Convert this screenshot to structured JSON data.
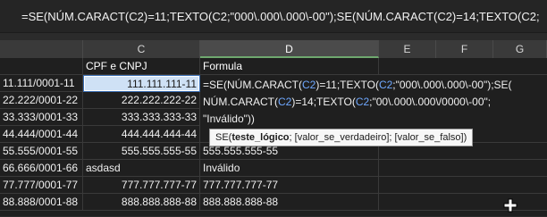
{
  "formula_bar": {
    "text": "=SE(NÚM.CARACT(C2)=11;TEXTO(C2;\"000\\.000\\.000\\-00\");SE(NÚM.CARACT(C2)=14;TEXTO(C2;"
  },
  "columns": [
    "C",
    "D",
    "E",
    "F",
    "G"
  ],
  "rows": [
    {
      "b": "",
      "c": "CPF e CNPJ",
      "d": "Formula"
    },
    {
      "b": "11.111/0001-11",
      "c": "111.111.111-11",
      "d": ""
    },
    {
      "b": "22.222/0001-22",
      "c": "222.222.222-22",
      "d": ""
    },
    {
      "b": "33.333/0001-33",
      "c": "333.333.333-33",
      "d": ""
    },
    {
      "b": "44.444/0001-44",
      "c": "444.444.444-44",
      "d": ""
    },
    {
      "b": "55.555/0001-55",
      "c": "555.555.555-55",
      "d": "555.555.555-55"
    },
    {
      "b": "66.666/0001-66",
      "c": "asdasd",
      "d": "Inválido"
    },
    {
      "b": "77.777/0001-77",
      "c": "777.777.777-77",
      "d": "777.777.777-77"
    },
    {
      "b": "88.888/0001-88",
      "c": "888.888.888-88",
      "d": "888.888.888-88"
    }
  ],
  "editing": {
    "line1_a": "=SE(NÚM.CARACT(",
    "line1_ref1": "C2",
    "line1_b": ")=11;TEXTO(",
    "line1_ref2": "C2",
    "line1_c": ";\"000\\.000\\.000\\-00\");SE(",
    "line2_a": "NÚM.CARACT(",
    "line2_ref1": "C2",
    "line2_b": ")=14;TEXTO(",
    "line2_ref2": "C2",
    "line2_c": ";\"00\\.000\\.000\\/0000\\-00\";",
    "line3": "\"Inválido\"))"
  },
  "tooltip": {
    "fn": "SE(",
    "arg1": "teste_lógico",
    "rest": "; [valor_se_verdadeiro]; [valor_se_falso])"
  },
  "icons": {
    "cursor": "crosshair-cursor-icon"
  }
}
